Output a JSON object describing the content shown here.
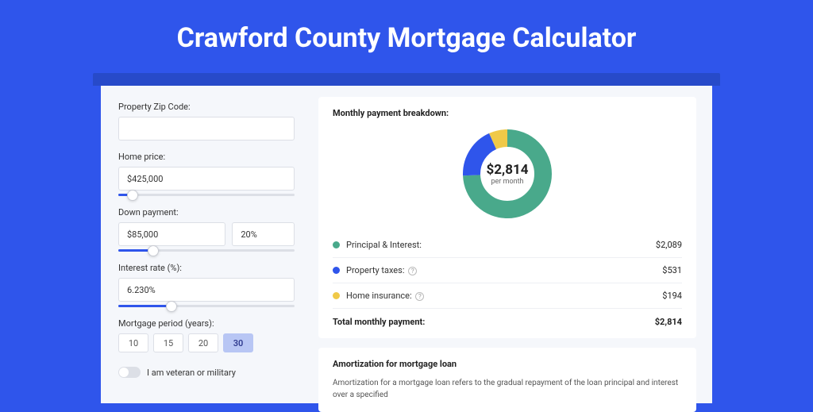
{
  "page_title": "Crawford County Mortgage Calculator",
  "form": {
    "zip_label": "Property Zip Code:",
    "zip_value": "",
    "home_price_label": "Home price:",
    "home_price_value": "$425,000",
    "home_price_slider_pct": 8,
    "down_payment_label": "Down payment:",
    "down_payment_value": "$85,000",
    "down_payment_pct_value": "20%",
    "down_payment_slider_pct": 20,
    "interest_label": "Interest rate (%):",
    "interest_value": "6.230%",
    "interest_slider_pct": 30,
    "period_label": "Mortgage period (years):",
    "periods": [
      "10",
      "15",
      "20",
      "30"
    ],
    "period_active": "30",
    "veteran_label": "I am veteran or military"
  },
  "breakdown": {
    "title": "Monthly payment breakdown:",
    "center_amount": "$2,814",
    "center_sub": "per month",
    "rows": [
      {
        "label": "Principal & Interest:",
        "value": "$2,089",
        "color": "#49a98b"
      },
      {
        "label": "Property taxes:",
        "value": "$531",
        "color": "#2f55eb",
        "help": true
      },
      {
        "label": "Home insurance:",
        "value": "$194",
        "color": "#f0c948",
        "help": true
      }
    ],
    "total_label": "Total monthly payment:",
    "total_value": "$2,814"
  },
  "chart_data": {
    "type": "pie",
    "title": "Monthly payment breakdown",
    "categories": [
      "Principal & Interest",
      "Property taxes",
      "Home insurance"
    ],
    "values": [
      2089,
      531,
      194
    ],
    "colors": [
      "#49a98b",
      "#2f55eb",
      "#f0c948"
    ],
    "total": 2814,
    "unit": "USD per month"
  },
  "amort": {
    "title": "Amortization for mortgage loan",
    "text": "Amortization for a mortgage loan refers to the gradual repayment of the loan principal and interest over a specified"
  }
}
